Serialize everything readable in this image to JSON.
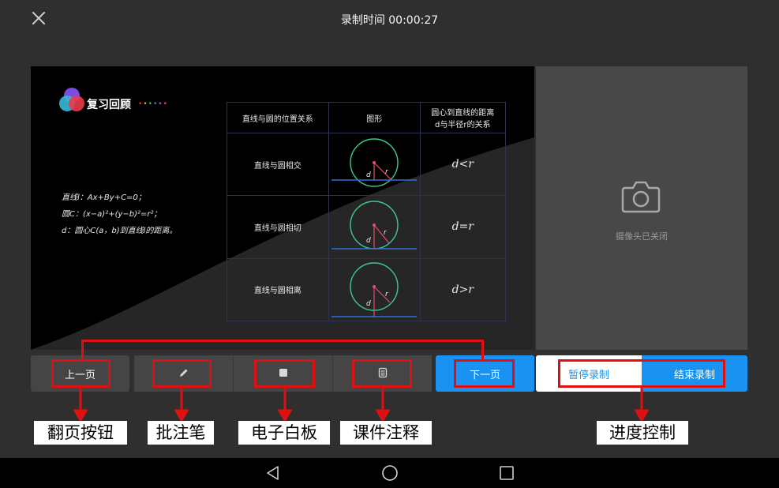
{
  "recording": {
    "title": "录制时间 00:00:27"
  },
  "slide": {
    "logo_text": "复习回顾",
    "formulas": [
      "直线l：Ax+By+C=0；",
      "圆C：(x−a)²+(y−b)²=r²；",
      "d：圆心C(a，b)到直线l的距离。"
    ],
    "table": {
      "headers": [
        "直线与圆的位置关系",
        "图形",
        "圆心到直线的距离",
        "d与半径r的关系"
      ],
      "rows": [
        {
          "relation": "直线与圆相交",
          "condition": "d<r"
        },
        {
          "relation": "直线与圆相切",
          "condition": "d=r"
        },
        {
          "relation": "直线与圆相离",
          "condition": "d>r"
        }
      ],
      "figure_labels": {
        "d": "d",
        "r": "r"
      }
    }
  },
  "camera": {
    "status": "摄像头已关闭"
  },
  "controls": {
    "prev": "上一页",
    "next": "下一页",
    "pause": "暂停录制",
    "end": "结束录制"
  },
  "annotations": {
    "page_turn": "翻页按钮",
    "pen": "批注笔",
    "whiteboard": "电子白板",
    "courseware": "课件注释",
    "progress": "进度控制"
  },
  "icons": {
    "close": "close-icon",
    "camera": "camera-icon",
    "pen": "pen-icon",
    "whiteboard": "square-icon",
    "courseware": "document-icon",
    "back": "back-triangle-icon",
    "home": "home-circle-icon",
    "recents": "recents-square-icon"
  },
  "colors": {
    "accent": "#1a92f2",
    "annotation_red": "#e01010",
    "logo_dot_colors": [
      "#e23b3b",
      "#f0a020",
      "#3ac24a",
      "#2a8cf0",
      "#a050e0",
      "#e84090"
    ]
  }
}
